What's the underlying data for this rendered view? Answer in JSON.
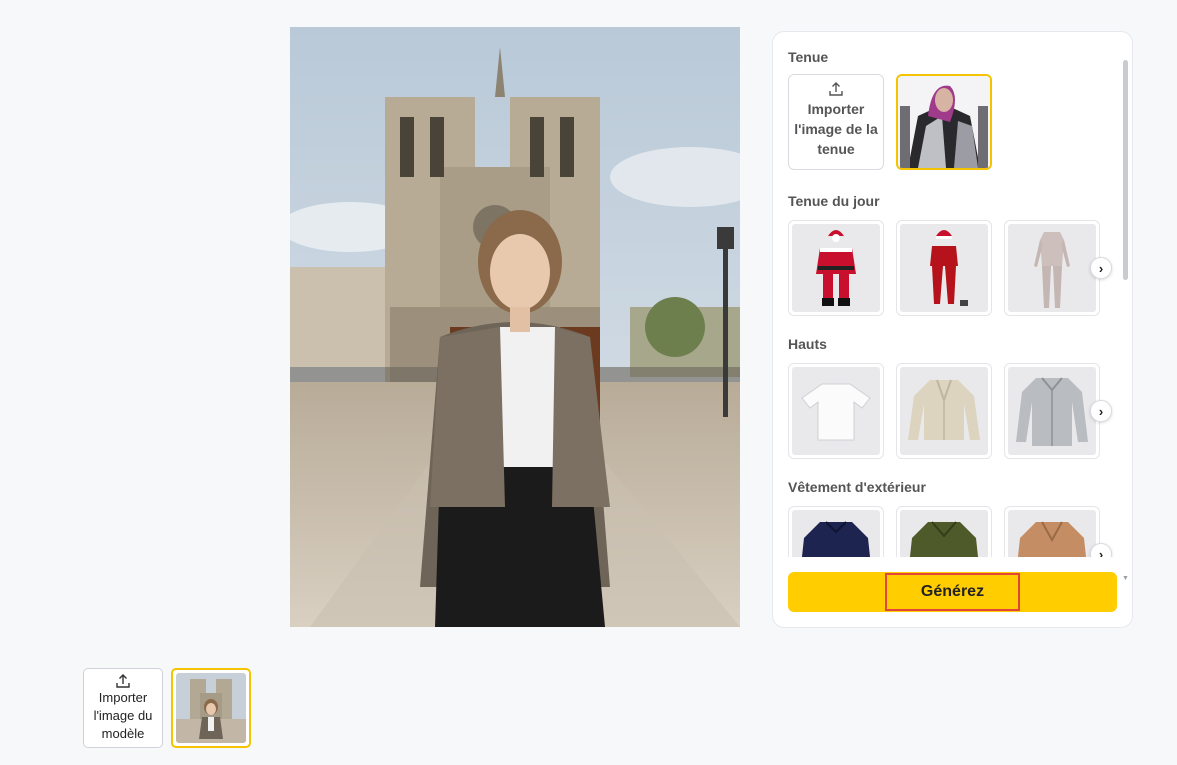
{
  "panel": {
    "sections": {
      "outfit": {
        "title": "Tenue",
        "upload_label": "Importer l'image de la tenue"
      },
      "daily": {
        "title": "Tenue du jour",
        "items": [
          "santa-suit",
          "red-outfit",
          "grey-jumpsuit"
        ]
      },
      "tops": {
        "title": "Hauts",
        "items": [
          "white-tshirt",
          "beige-cardigan",
          "grey-shirt"
        ]
      },
      "outerwear": {
        "title": "Vêtement d'extérieur",
        "items": [
          "navy-jacket",
          "green-jacket",
          "camel-coat"
        ]
      }
    },
    "generate_label": "Générez"
  },
  "model": {
    "upload_label": "Importer l'image du modèle"
  },
  "icons": {
    "upload": "upload-icon",
    "next": "chevron-right-icon"
  },
  "colors": {
    "accent": "#ffcd00",
    "highlight": "#e4453a",
    "background": "#f7f8fa"
  }
}
